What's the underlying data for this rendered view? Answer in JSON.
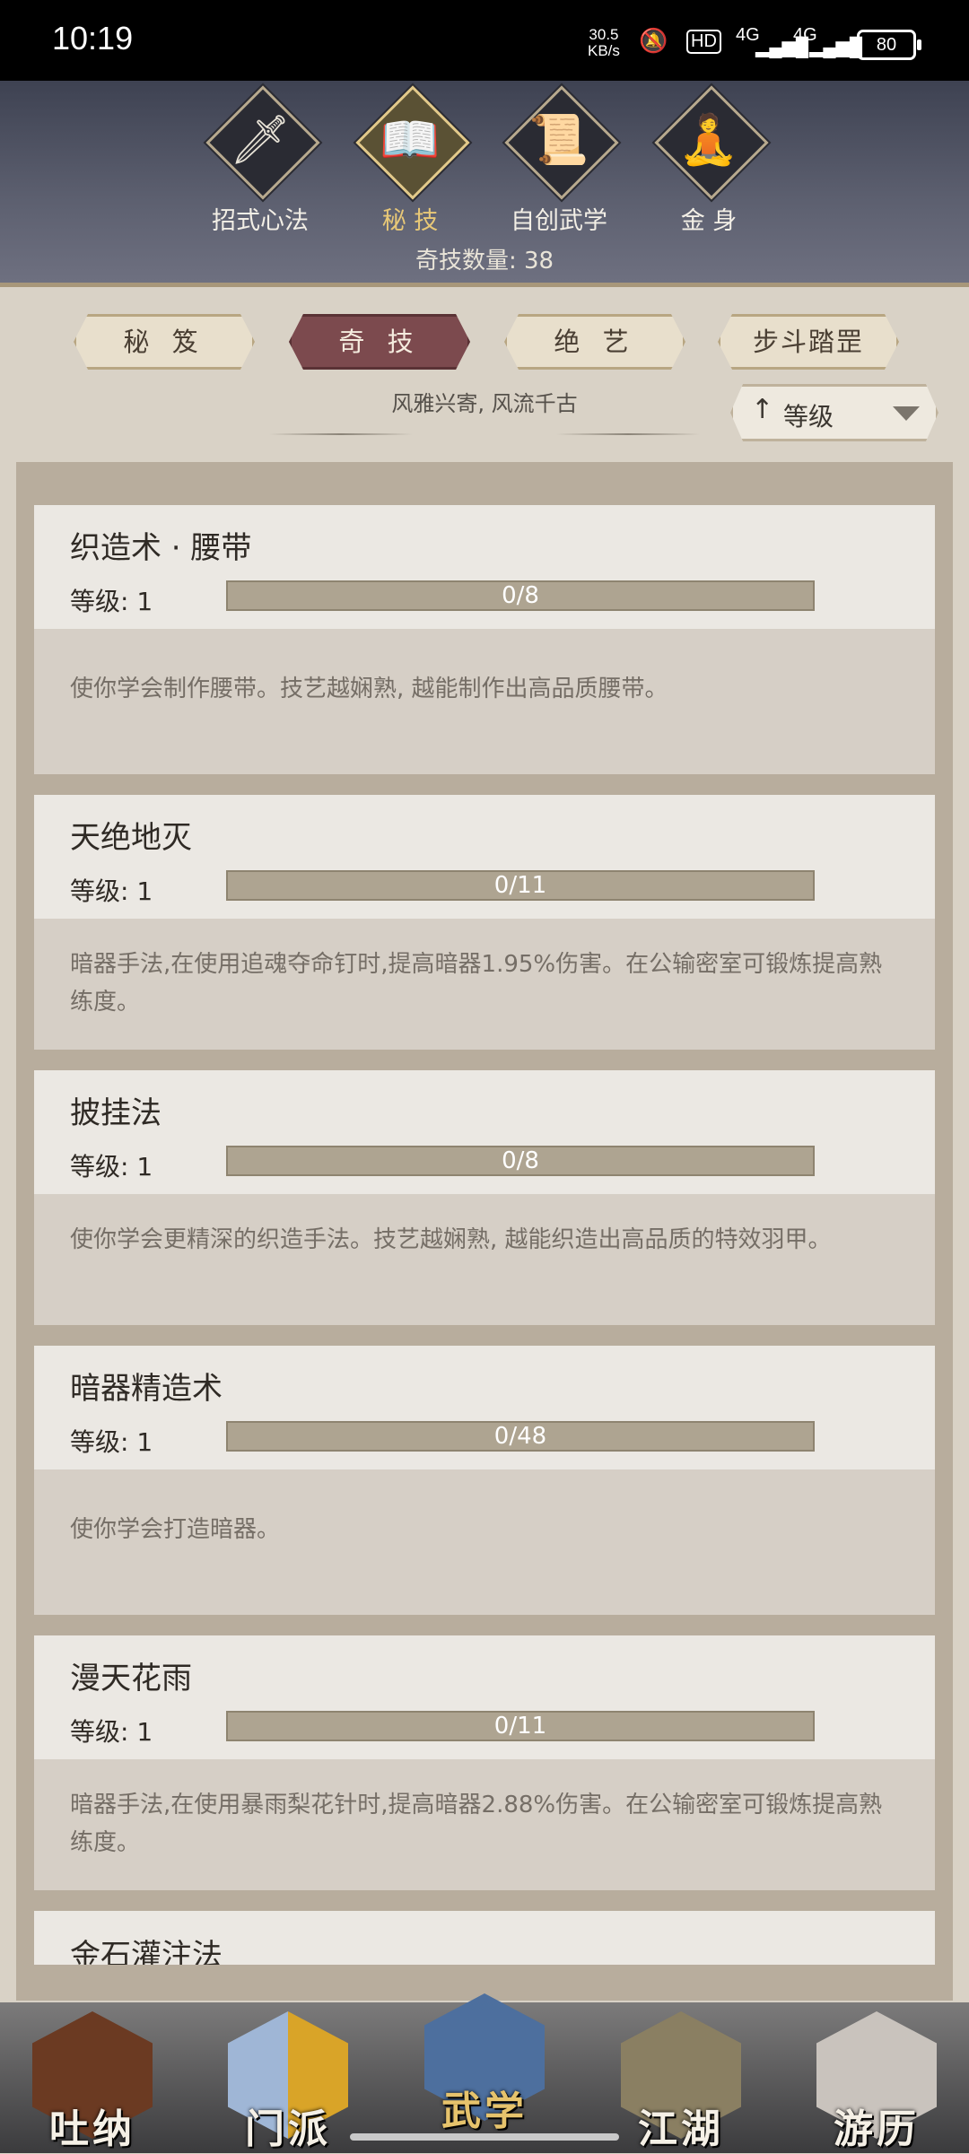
{
  "status_bar": {
    "time": "10:19",
    "net_speed_value": "30.5",
    "net_speed_unit": "KB/s",
    "hd_label": "HD",
    "signal1": "4G",
    "signal2": "4G",
    "battery": "80"
  },
  "top_tabs": [
    {
      "label": "招式心法",
      "icon": "sword-icon",
      "glyph": "🗡",
      "active": false
    },
    {
      "label": "秘 技",
      "icon": "book-icon",
      "glyph": "📖",
      "active": true
    },
    {
      "label": "自创武学",
      "icon": "scroll-icon",
      "glyph": "📜",
      "active": false
    },
    {
      "label": "金 身",
      "icon": "meditation-icon",
      "glyph": "🧘",
      "active": false
    }
  ],
  "tech_count_label": "奇技数量: 38",
  "sub_tabs": [
    {
      "label": "秘 笈",
      "active": false
    },
    {
      "label": "奇 技",
      "active": true
    },
    {
      "label": "绝 艺",
      "active": false
    },
    {
      "label": "步斗踏罡",
      "active": false
    }
  ],
  "motto": "风雅兴寄, 风流千古",
  "sort": {
    "arrow": "↑",
    "label": "等级"
  },
  "cards": [
    {
      "title": "织造术 · 腰带",
      "level": "等级: 1",
      "progress": "0/8",
      "progress_fraction": 0,
      "desc": "使你学会制作腰带。技艺越娴熟, 越能制作出高品质腰带。"
    },
    {
      "title": "天绝地灭",
      "level": "等级: 1",
      "progress": "0/11",
      "progress_fraction": 0,
      "desc": "暗器手法,在使用追魂夺命钉时,提高暗器1.95%伤害。在公输密室可锻炼提高熟练度。"
    },
    {
      "title": "披挂法",
      "level": "等级: 1",
      "progress": "0/8",
      "progress_fraction": 0,
      "desc": "使你学会更精深的织造手法。技艺越娴熟, 越能织造出高品质的特效羽甲。"
    },
    {
      "title": "暗器精造术",
      "level": "等级: 1",
      "progress": "0/48",
      "progress_fraction": 0,
      "desc": "使你学会打造暗器。"
    },
    {
      "title": "漫天花雨",
      "level": "等级: 1",
      "progress": "0/11",
      "progress_fraction": 0,
      "desc": "暗器手法,在使用暴雨梨花针时,提高暗器2.88%伤害。在公输密室可锻炼提高熟练度。"
    }
  ],
  "partial_card_title": "金石灌注法",
  "bottom_nav": [
    {
      "label": "吐纳",
      "icon": "monk-icon",
      "active": false
    },
    {
      "label": "门派",
      "icon": "sect-flags-icon",
      "active": false
    },
    {
      "label": "武学",
      "icon": "martial-books-icon",
      "active": true
    },
    {
      "label": "江湖",
      "icon": "straw-hat-icon",
      "active": false
    },
    {
      "label": "游历",
      "icon": "horse-icon",
      "active": false
    }
  ],
  "colors": {
    "header_bg": "#4a4d5c",
    "active_tab": "#7c4a4e",
    "gold": "#e8c877",
    "progress_bg": "#aea491"
  }
}
